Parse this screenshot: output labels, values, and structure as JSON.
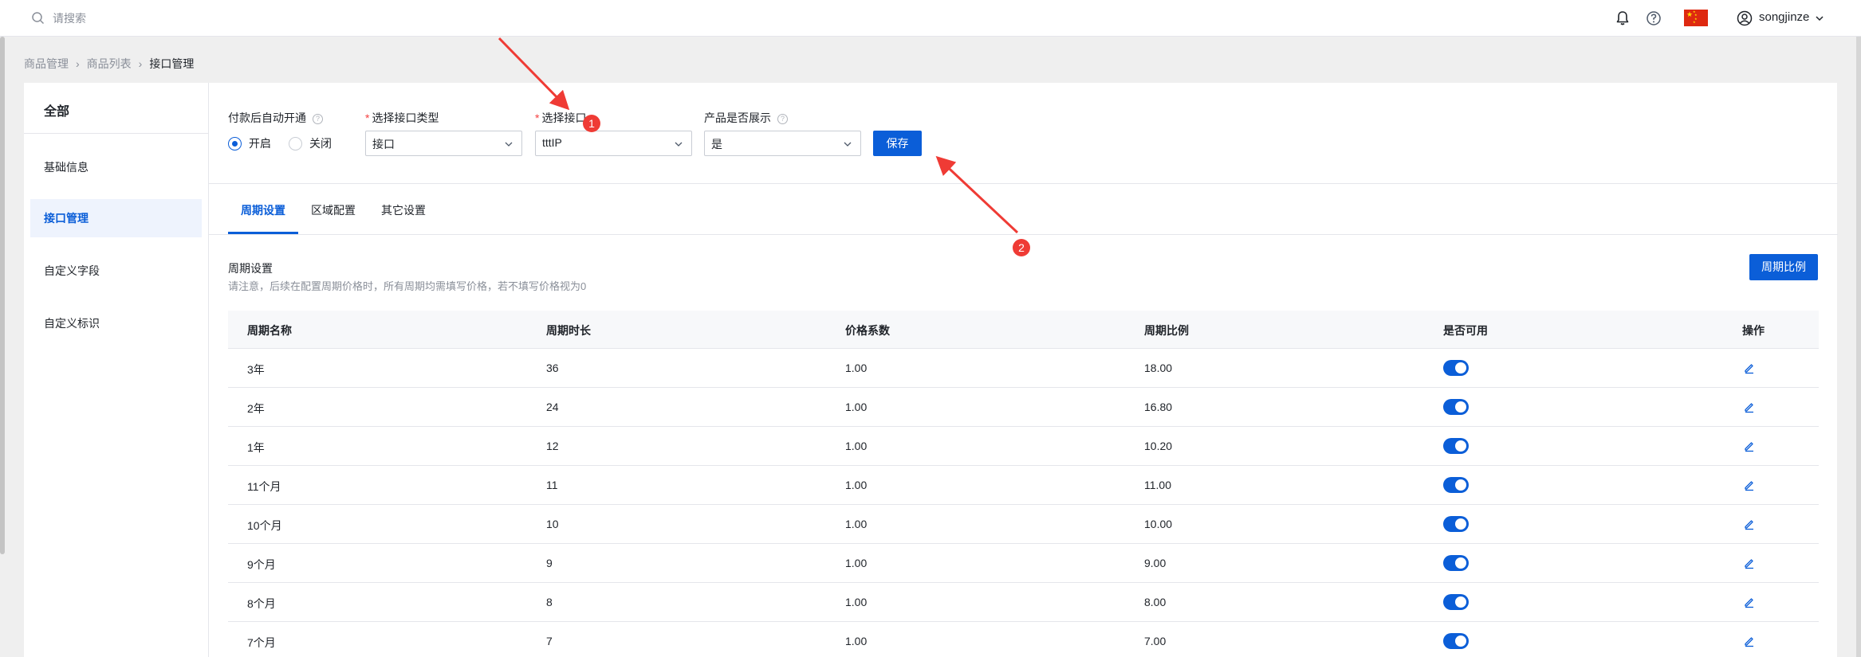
{
  "topbar": {
    "search_placeholder": "请搜索",
    "user_name": "songjinze"
  },
  "breadcrumb": [
    "商品管理",
    "商品列表",
    "接口管理"
  ],
  "sidebar": {
    "title": "全部",
    "items": [
      {
        "label": "基础信息",
        "active": false
      },
      {
        "label": "接口管理",
        "active": true
      },
      {
        "label": "自定义字段",
        "active": false
      },
      {
        "label": "自定义标识",
        "active": false
      }
    ]
  },
  "form": {
    "auto_open_label": "付款后自动开通",
    "radio_on": "开启",
    "radio_off": "关闭",
    "iface_type_label": "选择接口类型",
    "iface_type_value": "接口",
    "iface_label": "选择接口",
    "iface_value": "tttIP",
    "show_label": "产品是否展示",
    "show_value": "是",
    "save_label": "保存"
  },
  "tabs": [
    "周期设置",
    "区域配置",
    "其它设置"
  ],
  "section": {
    "title": "周期设置",
    "note": "请注意，后续在配置周期价格时，所有周期均需填写价格，若不填写价格视为0",
    "ratio_button": "周期比例"
  },
  "table": {
    "headers": [
      "周期名称",
      "周期时长",
      "价格系数",
      "周期比例",
      "是否可用",
      "操作"
    ],
    "rows": [
      {
        "name": "3年",
        "duration": "36",
        "coef": "1.00",
        "ratio": "18.00",
        "enabled": true
      },
      {
        "name": "2年",
        "duration": "24",
        "coef": "1.00",
        "ratio": "16.80",
        "enabled": true
      },
      {
        "name": "1年",
        "duration": "12",
        "coef": "1.00",
        "ratio": "10.20",
        "enabled": true
      },
      {
        "name": "11个月",
        "duration": "11",
        "coef": "1.00",
        "ratio": "11.00",
        "enabled": true
      },
      {
        "name": "10个月",
        "duration": "10",
        "coef": "1.00",
        "ratio": "10.00",
        "enabled": true
      },
      {
        "name": "9个月",
        "duration": "9",
        "coef": "1.00",
        "ratio": "9.00",
        "enabled": true
      },
      {
        "name": "8个月",
        "duration": "8",
        "coef": "1.00",
        "ratio": "8.00",
        "enabled": true
      },
      {
        "name": "7个月",
        "duration": "7",
        "coef": "1.00",
        "ratio": "7.00",
        "enabled": true
      }
    ]
  },
  "annotations": [
    "1",
    "2"
  ],
  "colors": {
    "accent": "#0b5ed8",
    "annotation": "#ef3b35",
    "flag": "#de2910"
  }
}
